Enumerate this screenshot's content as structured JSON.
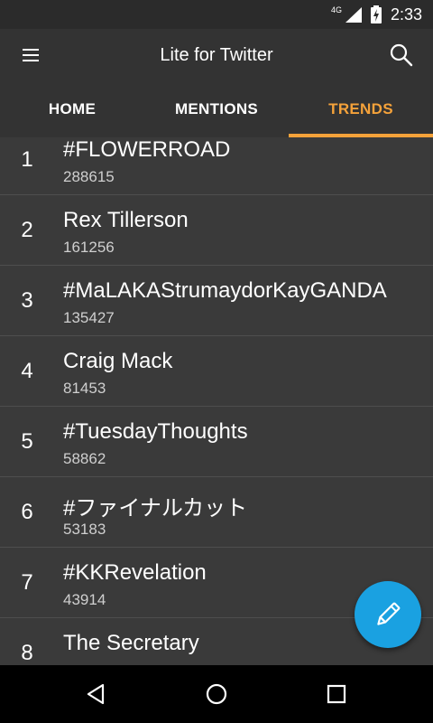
{
  "status_bar": {
    "network": "4G",
    "time": "2:33",
    "icons": [
      "signal-icon",
      "battery-charging-icon"
    ]
  },
  "app_bar": {
    "title": "Lite for Twitter",
    "icons": [
      "menu-icon",
      "search-icon"
    ]
  },
  "tabs": [
    {
      "label": "HOME",
      "active": false
    },
    {
      "label": "MENTIONS",
      "active": false
    },
    {
      "label": "TRENDS",
      "active": true
    }
  ],
  "accent_color": "#f5a23a",
  "fab_color": "#1aa1e1",
  "trends": [
    {
      "rank": "1",
      "name": "#FLOWERROAD",
      "count": "288615"
    },
    {
      "rank": "2",
      "name": "Rex Tillerson",
      "count": "161256"
    },
    {
      "rank": "3",
      "name": "#MaLAKAStrumaydorKayGANDA",
      "count": "135427"
    },
    {
      "rank": "4",
      "name": "Craig Mack",
      "count": "81453"
    },
    {
      "rank": "5",
      "name": "#TuesdayThoughts",
      "count": "58862"
    },
    {
      "rank": "6",
      "name": "#ファイナルカット",
      "count": "53183"
    },
    {
      "rank": "7",
      "name": "#KKRevelation",
      "count": "43914"
    },
    {
      "rank": "8",
      "name": "The Secretary",
      "count": ""
    }
  ],
  "fab": {
    "icon": "pencil-icon"
  },
  "nav_bar": {
    "icons": [
      "back-icon",
      "home-icon",
      "recents-icon"
    ]
  }
}
